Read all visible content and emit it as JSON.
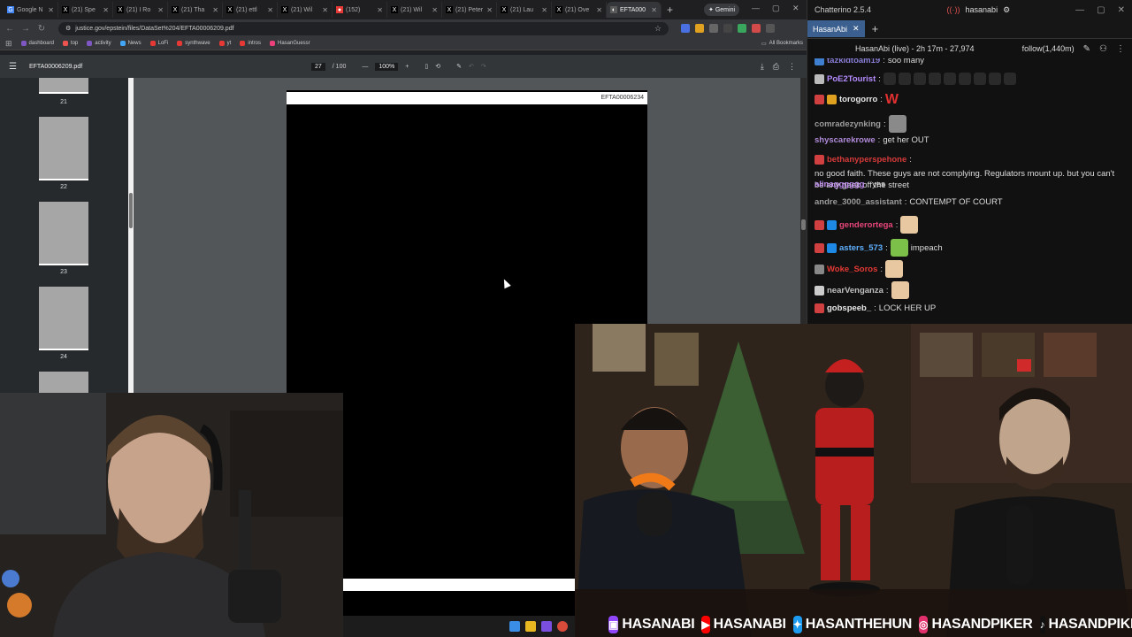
{
  "browser": {
    "tabs": [
      {
        "label": "Google N",
        "icon": "G",
        "color": "#4285f4"
      },
      {
        "label": "(21) Spe",
        "icon": "X",
        "color": "#000"
      },
      {
        "label": "(21) I Ro",
        "icon": "X",
        "color": "#000"
      },
      {
        "label": "(21) Tha",
        "icon": "X",
        "color": "#000"
      },
      {
        "label": "(21) ettl",
        "icon": "X",
        "color": "#000"
      },
      {
        "label": "(21) Wil",
        "icon": "X",
        "color": "#000"
      },
      {
        "label": "(152)",
        "icon": "●",
        "color": "#e53935"
      },
      {
        "label": "(21) Wil",
        "icon": "X",
        "color": "#000"
      },
      {
        "label": "(21) Peter",
        "icon": "X",
        "color": "#000"
      },
      {
        "label": "(21) Lau",
        "icon": "X",
        "color": "#000"
      },
      {
        "label": "(21) Ove",
        "icon": "X",
        "color": "#000"
      },
      {
        "label": "EFTA000",
        "icon": "◐",
        "color": "#5a5a5a"
      }
    ],
    "gemini_label": "Gemini",
    "url": "justice.gov/epstein/files/DataSet%204/EFTA00006209.pdf",
    "bookmarks": [
      {
        "label": "dashboard",
        "color": "#7e57c2"
      },
      {
        "label": "top",
        "color": "#ef5350"
      },
      {
        "label": "activity",
        "color": "#7e57c2"
      },
      {
        "label": "News",
        "color": "#42a5f5"
      },
      {
        "label": "LoFi",
        "color": "#e53935"
      },
      {
        "label": "synthwave",
        "color": "#e53935"
      },
      {
        "label": "yt",
        "color": "#e53935"
      },
      {
        "label": "intros",
        "color": "#e53935"
      },
      {
        "label": "HasanGuessr",
        "color": "#ec407a"
      }
    ],
    "all_bookmarks_label": "All Bookmarks"
  },
  "pdf": {
    "filename": "EFTA00006209.pdf",
    "page_current": "27",
    "page_total": "/ 100",
    "zoom": "100%",
    "page_header_text": "EFTA00006234",
    "thumbnails": [
      {
        "label": "21"
      },
      {
        "label": "22"
      },
      {
        "label": "23"
      },
      {
        "label": "24"
      }
    ]
  },
  "chat": {
    "app_title": "Chatterino 2.5.4",
    "account": "hasanabi",
    "tab_label": "HasanAbi",
    "channel_status": "HasanAbi (live) - 2h 17m - 27,974",
    "follow_label": "follow(1,440m)",
    "messages": [
      {
        "user": "tazkidtoam19",
        "text": "soo many",
        "color": "#8a7fd8"
      },
      {
        "user": "PoE2Tourist",
        "text": "",
        "color": "#b58cff"
      },
      {
        "user": "torogorro",
        "text": "W",
        "color": "#e8e8e8"
      },
      {
        "user": "comradezynking",
        "text": "",
        "color": "#9c9c9c"
      },
      {
        "user": "shyscarekrowe",
        "text": "get her OUT",
        "color": "#b08ad8"
      },
      {
        "user": "bethanyperspehone",
        "text": "no good faith. These guys are not complying. Regulators mount up. but you can't be any geek off the street",
        "color": "#d63a3a"
      },
      {
        "user": "alinagggggg",
        "text": "yes",
        "color": "#c08cf0"
      },
      {
        "user": "andre_3000_assistant",
        "text": "CONTEMPT OF COURT",
        "color": "#9c9c9c"
      },
      {
        "user": "genderortega",
        "text": "",
        "color": "#e8467a"
      },
      {
        "user": "asters_573",
        "text": "impeach",
        "color": "#5fb0ff"
      },
      {
        "user": "Woke_Soros",
        "text": "",
        "color": "#e53935"
      },
      {
        "user": "nearVenganza",
        "text": "",
        "color": "#c0c0c0"
      },
      {
        "user": "gobspeeb_",
        "text": "LOCK HER UP",
        "color": "#e8e8e8"
      }
    ]
  },
  "socials": [
    {
      "name": "HASANABI",
      "icon": "twitch-icon",
      "color": "#9146ff",
      "glyph": "▣"
    },
    {
      "name": "HASANABI",
      "icon": "youtube-icon",
      "color": "#ff0000",
      "glyph": "▶"
    },
    {
      "name": "HASANTHEHUN",
      "icon": "twitter-icon",
      "color": "#1d9bf0",
      "glyph": "✦"
    },
    {
      "name": "HASANDPIKER",
      "icon": "instagram-icon",
      "color": "#e1306c",
      "glyph": "◎"
    },
    {
      "name": "HASANDPIKER",
      "icon": "tiktok-icon",
      "color": "#111111",
      "glyph": "♪"
    }
  ]
}
